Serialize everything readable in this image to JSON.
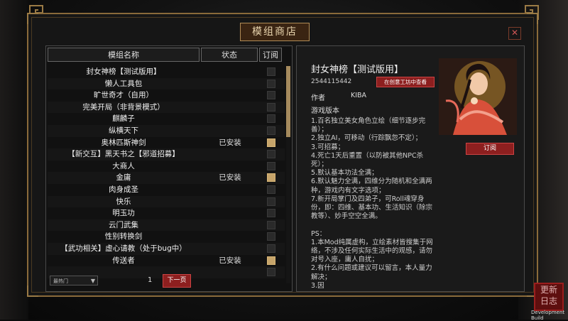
{
  "window": {
    "title": "模组商店",
    "close_icon": "close-icon"
  },
  "table": {
    "headers": [
      "模组名称",
      "状态",
      "订阅"
    ],
    "rows": [
      {
        "name": "封女神榜【测试版用】",
        "status": "",
        "subscribed": false
      },
      {
        "name": "懒人工具包",
        "status": "",
        "subscribed": false
      },
      {
        "name": "旷世奇才（自用）",
        "status": "",
        "subscribed": false
      },
      {
        "name": "完美开局（非背景模式）",
        "status": "",
        "subscribed": false
      },
      {
        "name": "麒麟子",
        "status": "",
        "subscribed": false
      },
      {
        "name": "纵横天下",
        "status": "",
        "subscribed": false
      },
      {
        "name": "奥林匹斯神剑",
        "status": "已安装",
        "subscribed": true
      },
      {
        "name": "【新交互】黑天书之【邪道招募】",
        "status": "",
        "subscribed": false
      },
      {
        "name": "大商人",
        "status": "",
        "subscribed": false
      },
      {
        "name": "金庸",
        "status": "已安装",
        "subscribed": true
      },
      {
        "name": "肉身成圣",
        "status": "",
        "subscribed": false
      },
      {
        "name": "快乐",
        "status": "",
        "subscribed": false
      },
      {
        "name": "明玉功",
        "status": "",
        "subscribed": false
      },
      {
        "name": "云门武集",
        "status": "",
        "subscribed": false
      },
      {
        "name": "性别转换剑",
        "status": "",
        "subscribed": false
      },
      {
        "name": "【武功相关】虚心请教（处于bug中）",
        "status": "",
        "subscribed": false
      },
      {
        "name": "传送者",
        "status": "已安装",
        "subscribed": true
      },
      {
        "name": "",
        "status": "",
        "subscribed": false
      }
    ]
  },
  "footer": {
    "sort_selected": "最热门",
    "page": "1",
    "next_label": "下一页"
  },
  "detail": {
    "title": "封女神榜【测试版用】",
    "id": "2544115442",
    "view_button": "在创意工坊中查看",
    "author_label": "作者",
    "author": "KIBA",
    "version_label": "游戏版本",
    "subscribe_button": "订阅",
    "description": "1.百名独立美女角色立绘（细节逐步完善）；\n2.独立AI，可移动（行踪飘忽不定）；\n3.可招募；\n4.死亡1天后重置（以防被其他NPC杀死）；\n5.默认基本功法全满；\n6.默认魅力全满，四维分为随机和全满两种，游戏内有文字选项；\n7.新开局掌门及四弟子，可Roll魂穿身份，即：四维、基本功、生活知识（除宗教等）、妙手空空全满。\n\nPS：\n1.本Mod纯属虚构，立绘素材皆搜集于网络，不涉及任何实际生活中的观感，请勿对号入座，庸人自扰；\n2.有什么问题或建议可以留言，本人量力解决；\n3.因"
  },
  "side_stamp": {
    "line1": "更新",
    "line2": "日志"
  },
  "dev_build": "Development Build",
  "colors": {
    "accent_red": "#8d1f1f",
    "gold": "#c6a46a",
    "frame": "#8a6a3a"
  }
}
